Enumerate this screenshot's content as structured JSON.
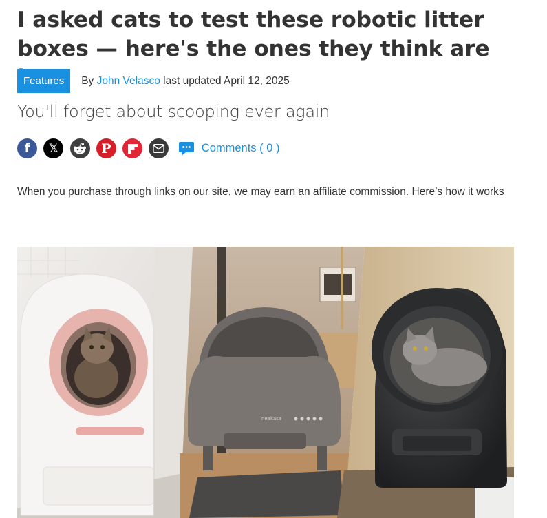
{
  "article": {
    "title": "I asked cats to test these robotic litter boxes — here's the ones they think are best",
    "category": "Features",
    "byline_prefix": "By",
    "author": "John Velasco",
    "updated_text": "last updated April 12, 2025",
    "strapline": "You'll forget about scooping ever again"
  },
  "share": {
    "buttons": [
      {
        "name": "facebook",
        "glyph": "f"
      },
      {
        "name": "x",
        "glyph": "𝕏"
      },
      {
        "name": "reddit",
        "glyph": ""
      },
      {
        "name": "pinterest",
        "glyph": "P"
      },
      {
        "name": "flipboard",
        "glyph": ""
      },
      {
        "name": "email",
        "glyph": ""
      }
    ],
    "comments_label": "Comments ( 0 )"
  },
  "disclaimer": {
    "text": "When you purchase through links on our site, we may earn an affiliate commission.",
    "link": "Here’s how it works"
  },
  "hero": {
    "device_label": "neakasa",
    "colors": {
      "left_bg": "#e8e6e2",
      "mid_bg": "#b9a48e",
      "right_bg": "#d3c09d",
      "pink_ring": "#e7b3ad",
      "gray_unit": "#6e6966",
      "black_unit": "#2b2c2d"
    }
  }
}
